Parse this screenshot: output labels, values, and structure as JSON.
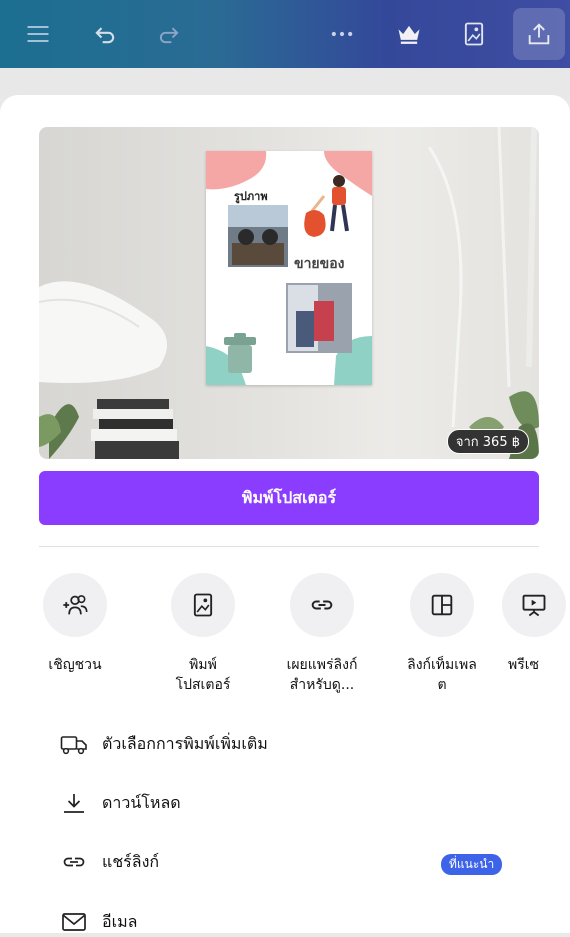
{
  "topbar": {
    "icons": [
      "menu-icon",
      "undo-icon",
      "redo-icon",
      "more-icon",
      "crown-icon",
      "poster-icon",
      "share-icon"
    ]
  },
  "preview": {
    "price_badge": "จาก 365 ฿",
    "poster": {
      "title_small": "รูปภาพ",
      "title_big": "ขายของ"
    }
  },
  "cta": {
    "label": "พิมพ์โปสเตอร์"
  },
  "actions": [
    {
      "label": "เชิญชวน",
      "icon": "add-people-icon"
    },
    {
      "label": "พิมพ์\nโปสเตอร์",
      "icon": "poster-icon"
    },
    {
      "label": "เผยแพร่ลิงก์\nสำหรับดู...",
      "icon": "link-icon"
    },
    {
      "label": "ลิงก์เท็มเพล\nต",
      "icon": "template-icon"
    },
    {
      "label": "พรีเซ",
      "icon": "present-icon"
    }
  ],
  "options": [
    {
      "label": "ตัวเลือกการพิมพ์เพิ่มเติม",
      "icon": "delivery-truck-icon"
    },
    {
      "label": "ดาวน์โหลด",
      "icon": "download-icon"
    },
    {
      "label": "แชร์ลิงก์",
      "icon": "link-icon",
      "tag": "ที่แนะนำ"
    },
    {
      "label": "อีเมล",
      "icon": "mail-icon"
    }
  ],
  "colors": {
    "cta": "#8b3dff",
    "tag": "#3d63e9"
  }
}
